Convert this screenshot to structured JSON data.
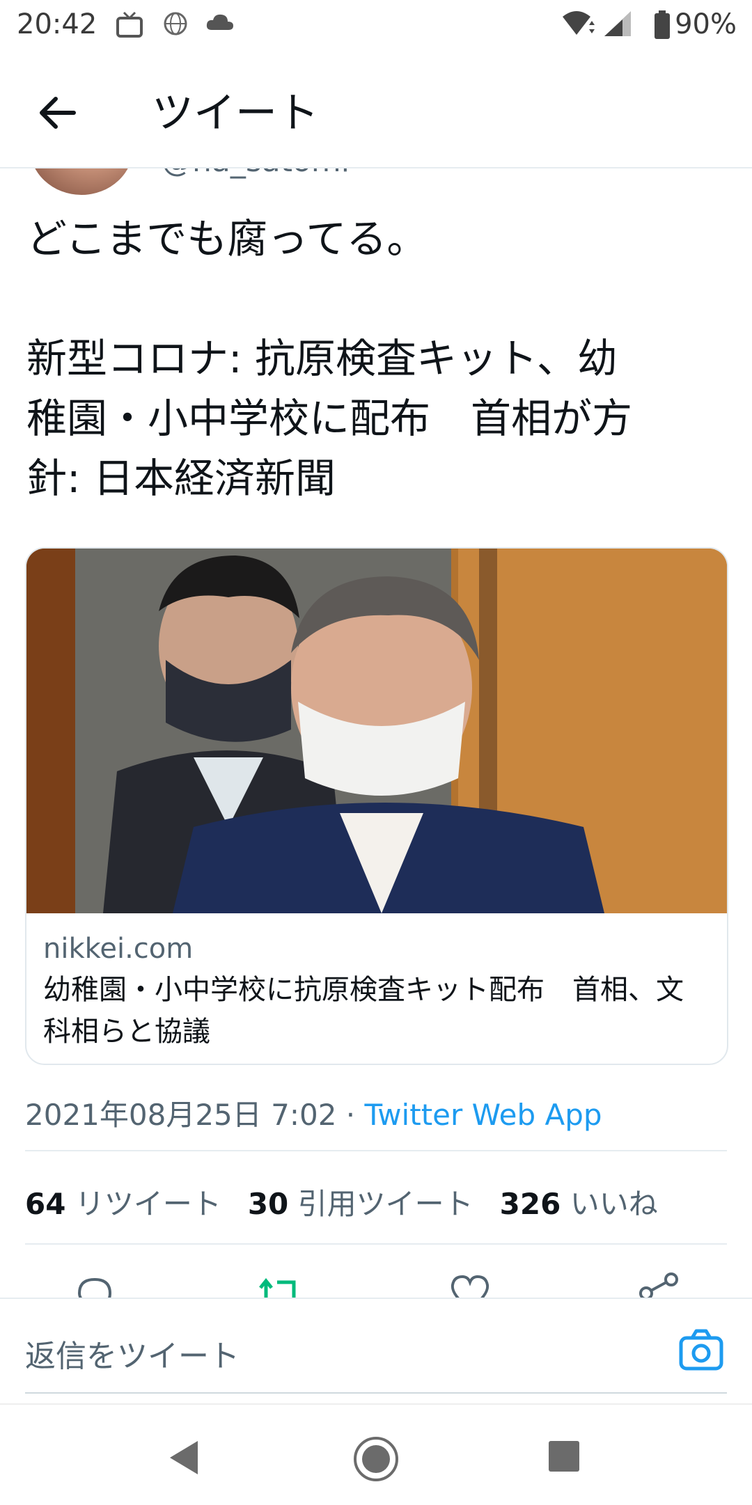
{
  "status_bar": {
    "time": "20:42",
    "battery": "90%",
    "icons": [
      "tv-icon",
      "vpn-globe-icon",
      "cloud-icon",
      "wifi-icon",
      "signal-icon",
      "battery-icon"
    ]
  },
  "header": {
    "title": "ツイート",
    "back_icon": "back-arrow-icon"
  },
  "tweet": {
    "handle": "@na_satomi",
    "text": "どこまでも腐ってる。\n\n新型コロナ: 抗原検査キット、幼\n稚園・小中学校に配布　首相が方\n針: 日本経済新聞",
    "card": {
      "domain": "nikkei.com",
      "title": "幼稚園・小中学校に抗原検査キット配布　首相、文科相らと協議"
    },
    "timestamp": "2021年08月25日 7:02 · ",
    "source_app": "Twitter Web App",
    "stats": {
      "retweets_count": "64",
      "retweets_label": "リツイート",
      "quotes_count": "30",
      "quotes_label": "引用ツイート",
      "likes_count": "326",
      "likes_label": "いいね"
    },
    "actions": [
      "reply-icon",
      "retweet-icon",
      "like-icon",
      "share-icon"
    ]
  },
  "reply_bar": {
    "placeholder": "返信をツイート",
    "camera_icon": "camera-icon"
  },
  "nav_bar": {
    "buttons": [
      "nav-back-icon",
      "nav-home-icon",
      "nav-recents-icon"
    ]
  },
  "colors": {
    "accent": "#1d9bf0",
    "retweet_green": "#00ba7c",
    "text_primary": "#0f1419",
    "text_secondary": "#536471"
  }
}
